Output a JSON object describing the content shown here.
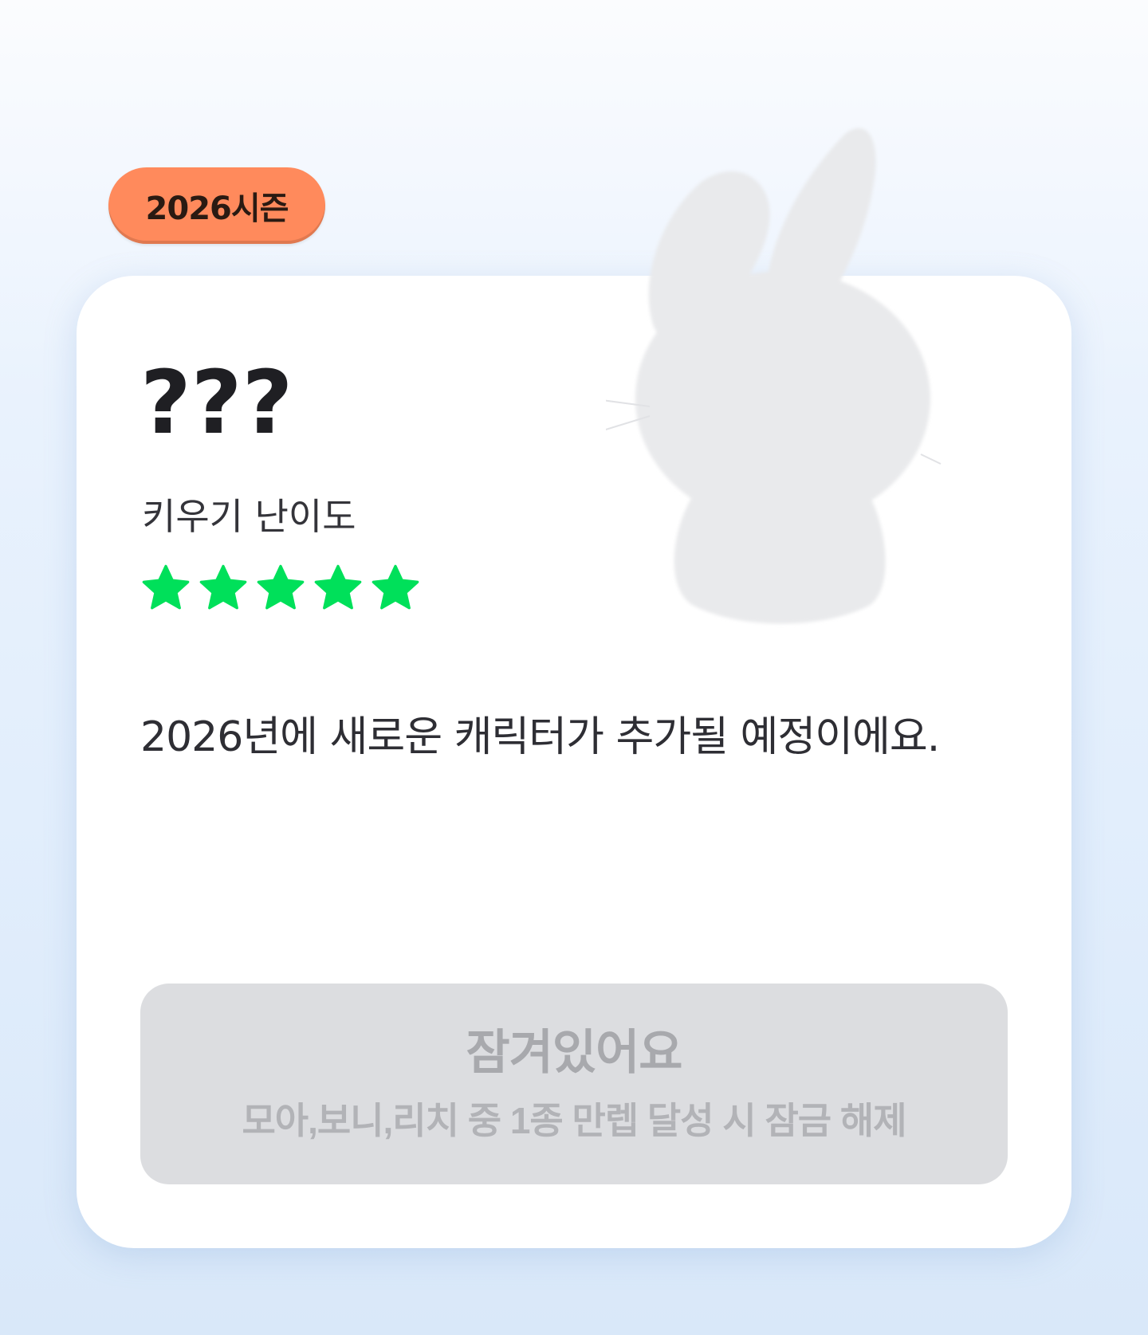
{
  "season_badge": {
    "label": "2026시즌",
    "color": "#ff8a5c"
  },
  "character": {
    "name": "???",
    "silhouette_icon": "rabbit-silhouette-icon",
    "difficulty_label": "키우기 난이도",
    "difficulty_rating": 5,
    "difficulty_max": 5,
    "star_color": "#00e05a",
    "description": "2026년에 새로운 캐릭터가 추가될 예정이에요."
  },
  "lock_button": {
    "title": "잠겨있어요",
    "subtitle": "모아,보니,리치 중 1종 만렙 달성 시 잠금 해제"
  }
}
